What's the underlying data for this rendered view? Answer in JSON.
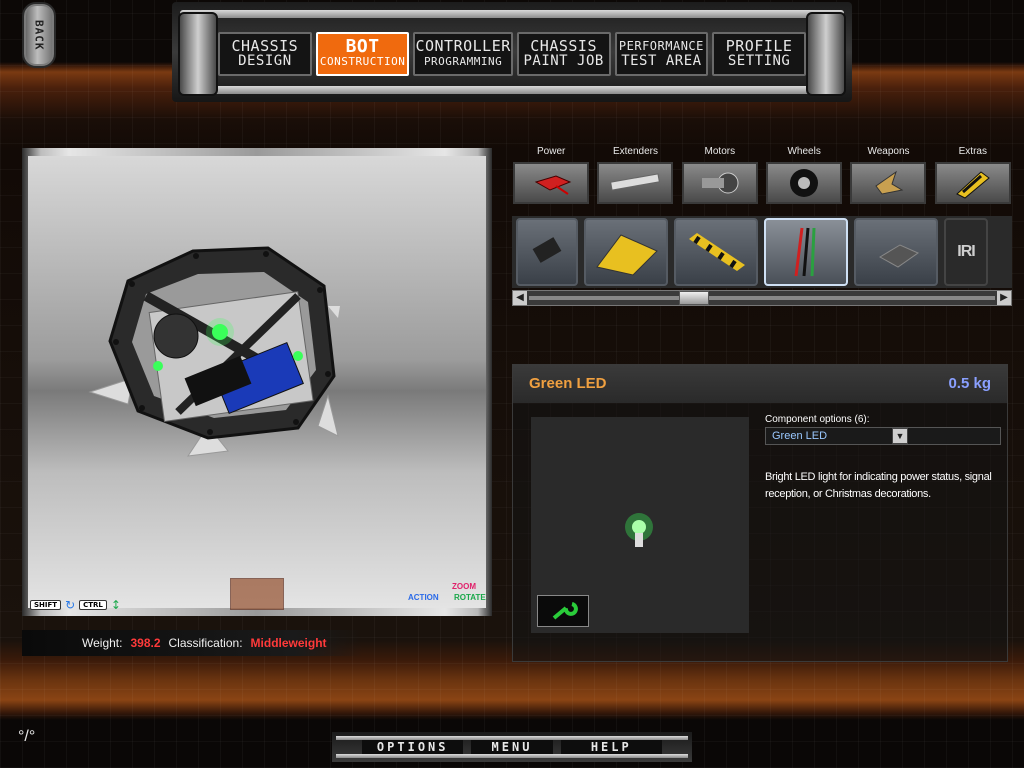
{
  "back": {
    "label": "BACK"
  },
  "nav": {
    "tabs": [
      {
        "line1": "CHASSIS",
        "line2": "DESIGN"
      },
      {
        "line1": "BOT",
        "line2": "CONSTRUCTION"
      },
      {
        "line1": "CONTROLLER",
        "line2": "PROGRAMMING"
      },
      {
        "line1": "CHASSIS",
        "line2": "PAINT JOB"
      },
      {
        "line1": "PERFORMANCE",
        "line2": "TEST AREA"
      },
      {
        "line1": "PROFILE",
        "line2": "SETTING"
      }
    ]
  },
  "viewport": {
    "shift_key": "SHIFT",
    "ctrl_key": "CTRL",
    "zoom": "ZOOM",
    "action": "ACTION",
    "rotate": "ROTATE"
  },
  "stats": {
    "weight_label": "Weight:",
    "weight_value": "398.2",
    "class_label": "Classification:",
    "class_value": "Middleweight"
  },
  "categories": [
    {
      "name": "Power",
      "icon": "battery-icon"
    },
    {
      "name": "Extenders",
      "icon": "extender-icon"
    },
    {
      "name": "Motors",
      "icon": "motor-icon"
    },
    {
      "name": "Wheels",
      "icon": "wheel-icon"
    },
    {
      "name": "Weapons",
      "icon": "weapon-icon"
    },
    {
      "name": "Extras",
      "icon": "extras-icon"
    }
  ],
  "strip": {
    "logo_text": "IRI"
  },
  "component": {
    "title": "Green LED",
    "weight": "0.5 kg",
    "options_label": "Component options (6):",
    "selected_option": "Green LED",
    "description": "Bright LED light for indicating power status, signal reception, or Christmas decorations."
  },
  "bottom": {
    "options": "OPTIONS",
    "menu": "MENU",
    "help": "HELP"
  },
  "colors": {
    "accent": "#f06a0e",
    "title": "#f0a040",
    "weight": "#8aa0ff",
    "danger": "#ff3a3a"
  }
}
